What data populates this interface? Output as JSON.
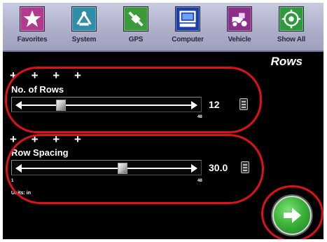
{
  "toolbar": {
    "items": [
      {
        "label": "Favorites",
        "icon": "star-icon",
        "color": "#b23a8f"
      },
      {
        "label": "System",
        "icon": "system-tools-icon",
        "color": "#2f8fa8"
      },
      {
        "label": "GPS",
        "icon": "satellite-icon",
        "color": "#3c9a3a"
      },
      {
        "label": "Computer",
        "icon": "computer-icon",
        "color": "#1a3fa6"
      },
      {
        "label": "Vehicle",
        "icon": "vehicle-icon",
        "color": "#8c2f8a"
      },
      {
        "label": "Show All",
        "icon": "show-all-icon",
        "color": "#2e9a3e"
      }
    ]
  },
  "page": {
    "title": "Rows"
  },
  "rows": {
    "label": "No. of Rows",
    "value": "12",
    "min": "",
    "max": "48",
    "position": 0.22,
    "plus_marks": "+ + + +"
  },
  "spacing": {
    "label": "Row Spacing",
    "value": "30.0",
    "min": "1",
    "max": "48",
    "position": 0.6,
    "plus_marks": "+ +  + +"
  },
  "units_note": "Units: in",
  "next": {
    "icon": "arrow-right-icon",
    "color": "#3cb53a"
  },
  "annotation_color": "#e0101a"
}
